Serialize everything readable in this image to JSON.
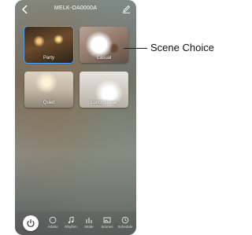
{
  "header": {
    "title": "MELK-OA0000A",
    "back_icon": "chevron-left-icon",
    "edit_icon": "pencil-icon"
  },
  "scenes": [
    {
      "label": "Party",
      "selected": true
    },
    {
      "label": "Casual",
      "selected": false
    },
    {
      "label": "Quiet",
      "selected": false
    },
    {
      "label": "Lunch Break",
      "selected": false
    }
  ],
  "bottom_nav": {
    "power_icon": "power-icon",
    "items": [
      {
        "label": "Adobe",
        "icon": "circle-icon"
      },
      {
        "label": "Rhythm",
        "icon": "music-icon"
      },
      {
        "label": "Mode",
        "icon": "bars-icon"
      },
      {
        "label": "Scenes",
        "icon": "image-icon"
      },
      {
        "label": "Schedule",
        "icon": "clock-icon"
      }
    ]
  },
  "annotation": {
    "label": "Scene Choice"
  },
  "colors": {
    "selected_outline": "#4da3ff"
  }
}
